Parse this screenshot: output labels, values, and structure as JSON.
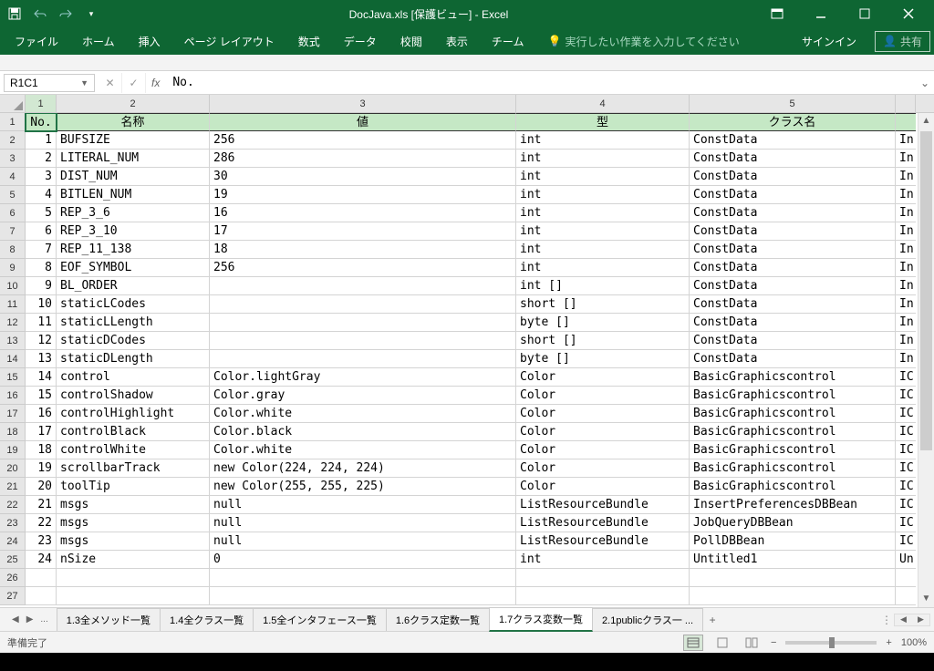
{
  "title": "DocJava.xls  [保護ビュー] - Excel",
  "qat": {
    "save": "save",
    "undo": "undo",
    "redo": "redo",
    "customize": "customize"
  },
  "winbtn": {
    "restore": "restore-down"
  },
  "ribbon": {
    "file": "ファイル",
    "home": "ホーム",
    "insert": "挿入",
    "layout": "ページ レイアウト",
    "formulas": "数式",
    "data": "データ",
    "review": "校閲",
    "view": "表示",
    "team": "チーム",
    "tell": "実行したい作業を入力してください",
    "signin": "サインイン",
    "share": "共有"
  },
  "nameBox": "R1C1",
  "formula": "No.",
  "colHeaders": [
    "1",
    "2",
    "3",
    "4",
    "5",
    ""
  ],
  "tableHeaders": {
    "c1": "No.",
    "c2": "名称",
    "c3": "値",
    "c4": "型",
    "c5": "クラス名",
    "c6": ""
  },
  "rows": [
    {
      "n": "1",
      "name": "BUFSIZE",
      "val": "256",
      "type": "int",
      "cls": "ConstData",
      "x": "In"
    },
    {
      "n": "2",
      "name": "LITERAL_NUM",
      "val": "286",
      "type": "int",
      "cls": "ConstData",
      "x": "In"
    },
    {
      "n": "3",
      "name": "DIST_NUM",
      "val": "30",
      "type": "int",
      "cls": "ConstData",
      "x": "In"
    },
    {
      "n": "4",
      "name": "BITLEN_NUM",
      "val": "19",
      "type": "int",
      "cls": "ConstData",
      "x": "In"
    },
    {
      "n": "5",
      "name": "REP_3_6",
      "val": "16",
      "type": "int",
      "cls": "ConstData",
      "x": "In"
    },
    {
      "n": "6",
      "name": "REP_3_10",
      "val": "17",
      "type": "int",
      "cls": "ConstData",
      "x": "In"
    },
    {
      "n": "7",
      "name": "REP_11_138",
      "val": "18",
      "type": "int",
      "cls": "ConstData",
      "x": "In"
    },
    {
      "n": "8",
      "name": "EOF_SYMBOL",
      "val": "256",
      "type": "int",
      "cls": "ConstData",
      "x": "In"
    },
    {
      "n": "9",
      "name": "BL_ORDER",
      "val": "",
      "type": "int []",
      "cls": "ConstData",
      "x": "In"
    },
    {
      "n": "10",
      "name": "staticLCodes",
      "val": "",
      "type": "short []",
      "cls": "ConstData",
      "x": "In"
    },
    {
      "n": "11",
      "name": "staticLLength",
      "val": "",
      "type": "byte []",
      "cls": "ConstData",
      "x": "In"
    },
    {
      "n": "12",
      "name": "staticDCodes",
      "val": "",
      "type": "short []",
      "cls": "ConstData",
      "x": "In"
    },
    {
      "n": "13",
      "name": "staticDLength",
      "val": "",
      "type": "byte []",
      "cls": "ConstData",
      "x": "In"
    },
    {
      "n": "14",
      "name": "control",
      "val": "Color.lightGray",
      "type": "Color",
      "cls": "BasicGraphicscontrol",
      "x": "IC"
    },
    {
      "n": "15",
      "name": "controlShadow",
      "val": "Color.gray",
      "type": "Color",
      "cls": "BasicGraphicscontrol",
      "x": "IC"
    },
    {
      "n": "16",
      "name": "controlHighlight",
      "val": "Color.white",
      "type": "Color",
      "cls": "BasicGraphicscontrol",
      "x": "IC"
    },
    {
      "n": "17",
      "name": "controlBlack",
      "val": "Color.black",
      "type": "Color",
      "cls": "BasicGraphicscontrol",
      "x": "IC"
    },
    {
      "n": "18",
      "name": "controlWhite",
      "val": "Color.white",
      "type": "Color",
      "cls": "BasicGraphicscontrol",
      "x": "IC"
    },
    {
      "n": "19",
      "name": "scrollbarTrack",
      "val": "new Color(224, 224, 224)",
      "type": "Color",
      "cls": "BasicGraphicscontrol",
      "x": "IC"
    },
    {
      "n": "20",
      "name": "toolTip",
      "val": "new Color(255, 255, 225)",
      "type": "Color",
      "cls": "BasicGraphicscontrol",
      "x": "IC"
    },
    {
      "n": "21",
      "name": "msgs",
      "val": "null",
      "type": "ListResourceBundle",
      "cls": "InsertPreferencesDBBean",
      "x": "IC"
    },
    {
      "n": "22",
      "name": "msgs",
      "val": "null",
      "type": "ListResourceBundle",
      "cls": "JobQueryDBBean",
      "x": "IC"
    },
    {
      "n": "23",
      "name": "msgs",
      "val": "null",
      "type": "ListResourceBundle",
      "cls": "PollDBBean",
      "x": "IC"
    },
    {
      "n": "24",
      "name": "nSize",
      "val": "0",
      "type": "int",
      "cls": "Untitled1",
      "x": "Un"
    }
  ],
  "emptyRowHeaders": [
    "26",
    "27"
  ],
  "sheetTabs": {
    "ellipsis": "...",
    "t1": "1.3全メソッド一覧",
    "t2": "1.4全クラス一覧",
    "t3": "1.5全インタフェース一覧",
    "t4": "1.6クラス定数一覧",
    "t5": "1.7クラス変数一覧",
    "t6": "2.1publicクラス一 ...",
    "add": "+"
  },
  "status": {
    "ready": "準備完了",
    "zoom": "100%",
    "minus": "−",
    "plus": "+"
  }
}
